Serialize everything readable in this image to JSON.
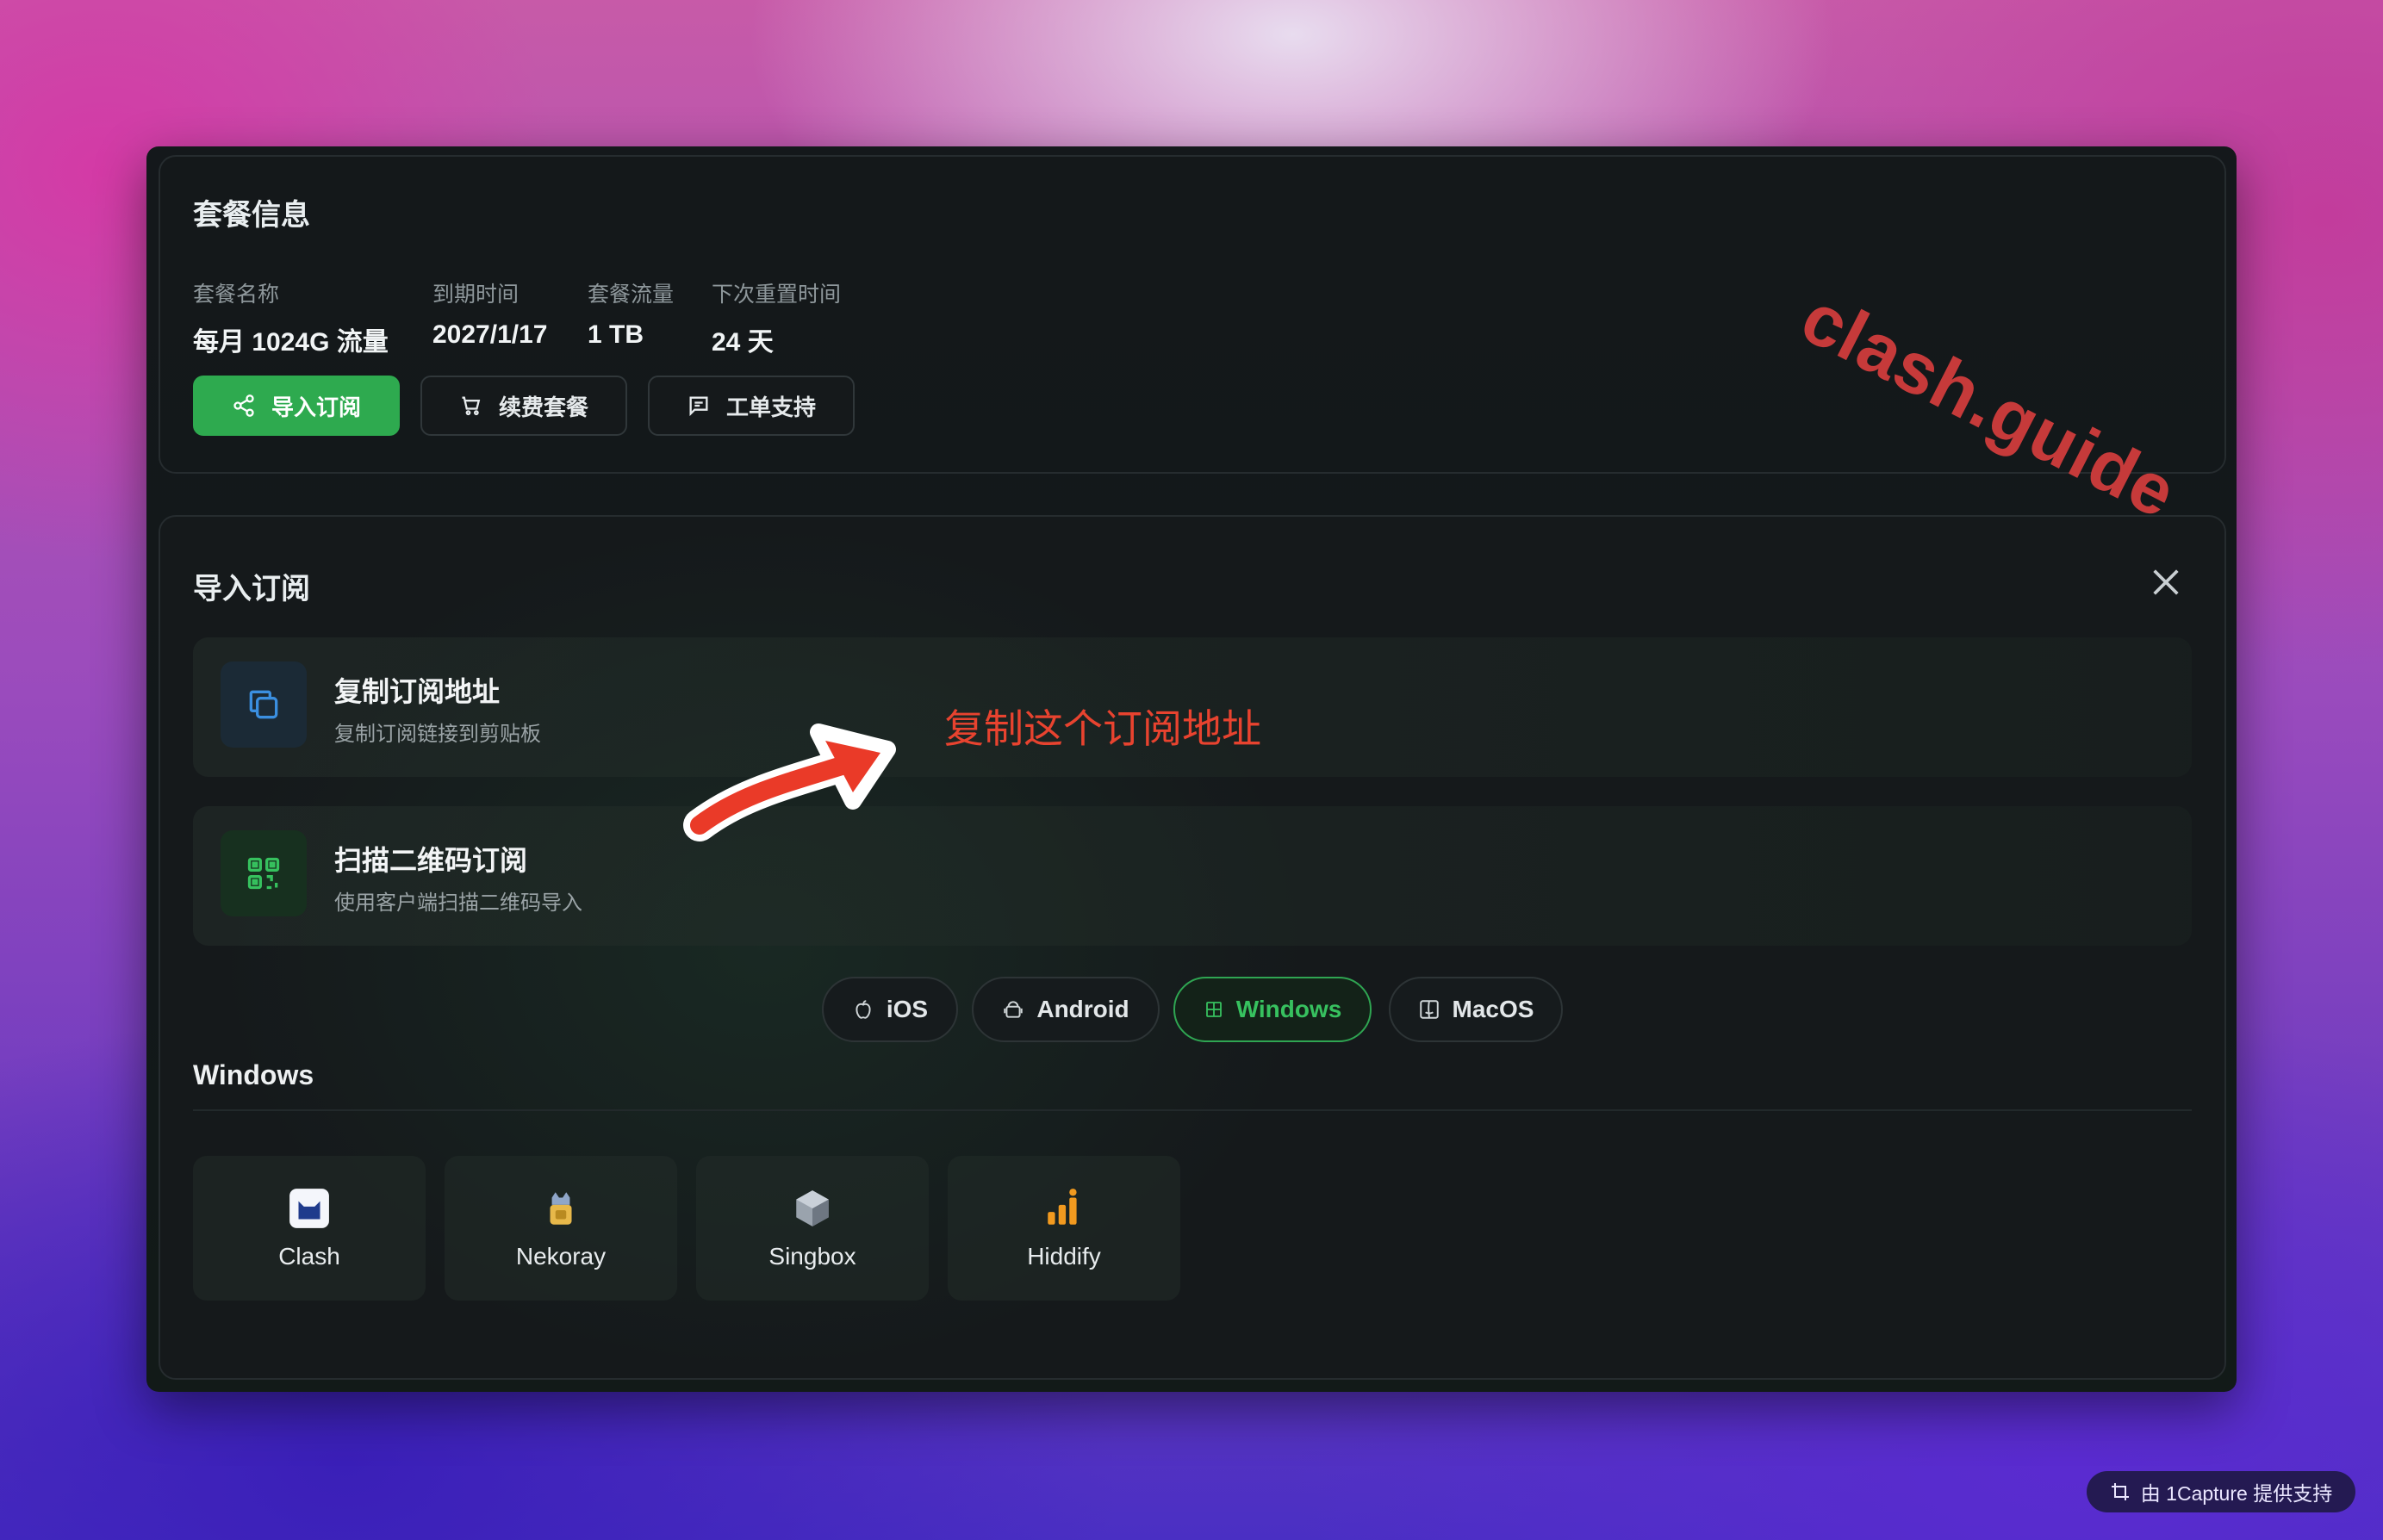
{
  "watermark": "clash.guide",
  "plan": {
    "title": "套餐信息",
    "fields": [
      {
        "label": "套餐名称",
        "value": "每月 1024G 流量"
      },
      {
        "label": "到期时间",
        "value": "2027/1/17"
      },
      {
        "label": "套餐流量",
        "value": "1 TB"
      },
      {
        "label": "下次重置时间",
        "value": "24 天"
      }
    ],
    "buttons": {
      "import": "导入订阅",
      "renew": "续费套餐",
      "ticket": "工单支持"
    }
  },
  "import": {
    "title": "导入订阅",
    "options": [
      {
        "title": "复制订阅地址",
        "subtitle": "复制订阅链接到剪贴板",
        "icon": "copy-icon"
      },
      {
        "title": "扫描二维码订阅",
        "subtitle": "使用客户端扫描二维码导入",
        "icon": "qrcode-icon"
      }
    ],
    "platform_tabs": [
      "iOS",
      "Android",
      "Windows",
      "MacOS"
    ],
    "selected_platform": "Windows",
    "section_title": "Windows",
    "apps": [
      "Clash",
      "Nekoray",
      "Singbox",
      "Hiddify"
    ]
  },
  "annotation": "复制这个订阅地址",
  "capture_badge": "由 1Capture 提供支持",
  "colors": {
    "accent_green": "#2eaa4f",
    "annotation_red": "#e8432f",
    "watermark_red": "#c63a3a"
  }
}
